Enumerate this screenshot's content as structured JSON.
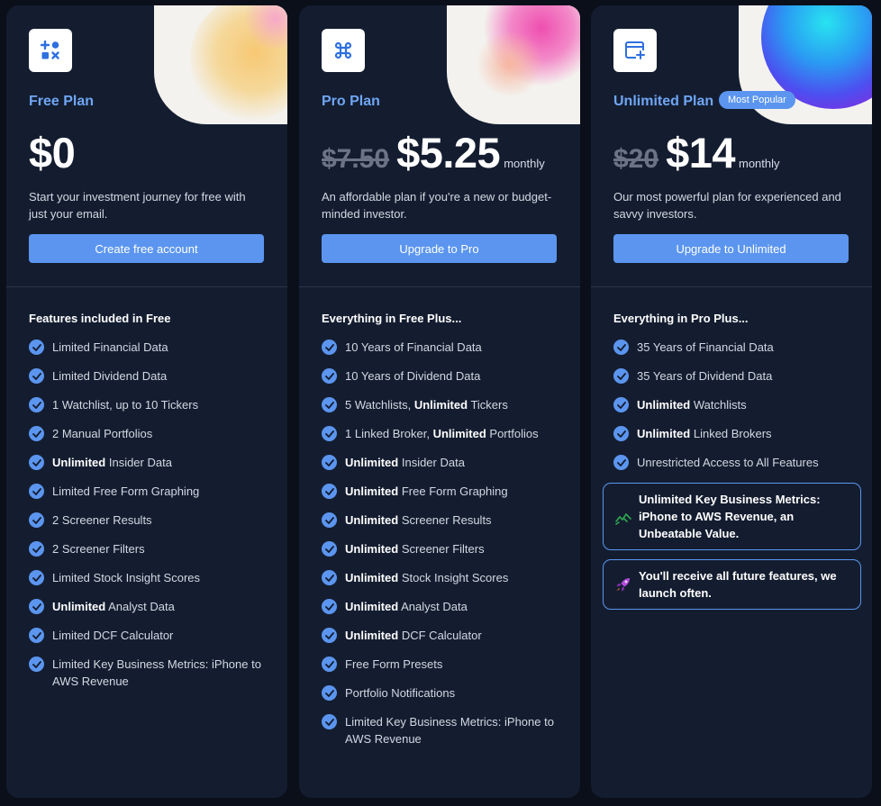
{
  "plans": [
    {
      "name": "Free Plan",
      "old_price": "",
      "price": "$0",
      "period": "",
      "badge": "",
      "description": "Start your investment journey for free with just your email.",
      "cta": "Create free account",
      "features_heading": "Features included in Free",
      "icon": "shapes-icon",
      "features": [
        {
          "bold": "",
          "text": "Limited Financial Data"
        },
        {
          "bold": "",
          "text": "Limited Dividend Data"
        },
        {
          "bold": "",
          "text": "1 Watchlist, up to 10 Tickers"
        },
        {
          "bold": "",
          "text": "2 Manual Portfolios"
        },
        {
          "bold": "Unlimited",
          "text": " Insider Data"
        },
        {
          "bold": "",
          "text": "Limited Free Form Graphing"
        },
        {
          "bold": "",
          "text": "2 Screener Results"
        },
        {
          "bold": "",
          "text": "2 Screener Filters"
        },
        {
          "bold": "",
          "text": "Limited Stock Insight Scores"
        },
        {
          "bold": "Unlimited",
          "text": " Analyst Data"
        },
        {
          "bold": "",
          "text": "Limited DCF Calculator"
        },
        {
          "bold": "",
          "text": "Limited Key Business Metrics: iPhone to AWS Revenue"
        }
      ]
    },
    {
      "name": "Pro Plan",
      "old_price": "$7.50",
      "price": "$5.25",
      "period": "monthly",
      "badge": "",
      "description": "An affordable plan if you're a new or budget-minded investor.",
      "cta": "Upgrade to Pro",
      "features_heading": "Everything in Free Plus...",
      "icon": "command-icon",
      "features": [
        {
          "bold": "",
          "text": "10 Years of Financial Data"
        },
        {
          "bold": "",
          "text": "10 Years of Dividend Data"
        },
        {
          "bold": "",
          "text": "5 Watchlists, ",
          "bold2": "Unlimited",
          "text2": " Tickers"
        },
        {
          "bold": "",
          "text": "1 Linked Broker, ",
          "bold2": "Unlimited",
          "text2": " Portfolios"
        },
        {
          "bold": "Unlimited",
          "text": " Insider Data"
        },
        {
          "bold": "Unlimited",
          "text": " Free Form Graphing"
        },
        {
          "bold": "Unlimited",
          "text": " Screener Results"
        },
        {
          "bold": "Unlimited",
          "text": " Screener Filters"
        },
        {
          "bold": "Unlimited",
          "text": " Stock Insight Scores"
        },
        {
          "bold": "Unlimited",
          "text": " Analyst Data"
        },
        {
          "bold": "Unlimited",
          "text": " DCF Calculator"
        },
        {
          "bold": "",
          "text": "Free Form Presets"
        },
        {
          "bold": "",
          "text": "Portfolio Notifications"
        },
        {
          "bold": "",
          "text": "Limited Key Business Metrics: iPhone to AWS Revenue"
        }
      ]
    },
    {
      "name": "Unlimited Plan",
      "old_price": "$20",
      "price": "$14",
      "period": "monthly",
      "badge": "Most Popular",
      "description": "Our most powerful plan for experienced and savvy investors.",
      "cta": "Upgrade to Unlimited",
      "features_heading": "Everything in Pro Plus...",
      "icon": "browser-sparkle-icon",
      "features": [
        {
          "bold": "",
          "text": "35 Years of Financial Data"
        },
        {
          "bold": "",
          "text": "35 Years of Dividend Data"
        },
        {
          "bold": "Unlimited",
          "text": " Watchlists"
        },
        {
          "bold": "Unlimited",
          "text": " Linked Brokers"
        },
        {
          "bold": "",
          "text": "Unrestricted Access to All Features"
        }
      ],
      "callouts": [
        {
          "icon": "chart-trend-icon",
          "text": "Unlimited Key Business Metrics: iPhone to AWS Revenue, an Unbeatable Value."
        },
        {
          "icon": "rocket-icon",
          "text": "You'll receive all future features, we launch often."
        }
      ]
    }
  ],
  "colors": {
    "background": "#0a0f1a",
    "card": "#141d30",
    "accent": "#5b95ef",
    "plan_name": "#6fa6f5"
  }
}
